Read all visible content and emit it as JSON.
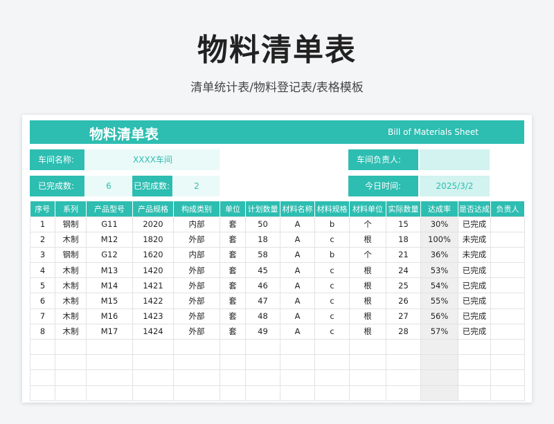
{
  "header": {
    "title": "物料清单表",
    "subtitle": "清单统计表/物料登记表/表格模板"
  },
  "sheet": {
    "title": "物料清单表",
    "title_en": "Bill of Materials Sheet",
    "info": {
      "workshop_label": "车间名称:",
      "workshop_value": "XXXX车间",
      "manager_label": "车间负责人:",
      "manager_value": "",
      "done_label_1": "已完成数:",
      "done_value_1": "6",
      "done_label_2": "已完成数:",
      "done_value_2": "2",
      "date_label": "今日时间:",
      "date_value": "2025/3/2"
    },
    "columns": [
      "序号",
      "系列",
      "产品型号",
      "产品规格",
      "构成类别",
      "单位",
      "计划数量",
      "材料名称",
      "材料规格",
      "材料单位",
      "实际数量",
      "达成率",
      "是否达成",
      "负责人"
    ],
    "rows": [
      [
        "1",
        "钢制",
        "G11",
        "2020",
        "内部",
        "套",
        "50",
        "A",
        "b",
        "个",
        "15",
        "30%",
        "已完成",
        ""
      ],
      [
        "2",
        "木制",
        "M12",
        "1820",
        "外部",
        "套",
        "18",
        "A",
        "c",
        "根",
        "18",
        "100%",
        "未完成",
        ""
      ],
      [
        "3",
        "钢制",
        "G12",
        "1620",
        "内部",
        "套",
        "58",
        "A",
        "b",
        "个",
        "21",
        "36%",
        "未完成",
        ""
      ],
      [
        "4",
        "木制",
        "M13",
        "1420",
        "外部",
        "套",
        "45",
        "A",
        "c",
        "根",
        "24",
        "53%",
        "已完成",
        ""
      ],
      [
        "5",
        "木制",
        "M14",
        "1421",
        "外部",
        "套",
        "46",
        "A",
        "c",
        "根",
        "25",
        "54%",
        "已完成",
        ""
      ],
      [
        "6",
        "木制",
        "M15",
        "1422",
        "外部",
        "套",
        "47",
        "A",
        "c",
        "根",
        "26",
        "55%",
        "已完成",
        ""
      ],
      [
        "7",
        "木制",
        "M16",
        "1423",
        "外部",
        "套",
        "48",
        "A",
        "c",
        "根",
        "27",
        "56%",
        "已完成",
        ""
      ],
      [
        "8",
        "木制",
        "M17",
        "1424",
        "外部",
        "套",
        "49",
        "A",
        "c",
        "根",
        "28",
        "57%",
        "已完成",
        ""
      ]
    ],
    "empty_rows": 4
  },
  "colors": {
    "accent": "#2dbdb1",
    "accent_light": "#eafaf8",
    "shade": "#efefef"
  }
}
